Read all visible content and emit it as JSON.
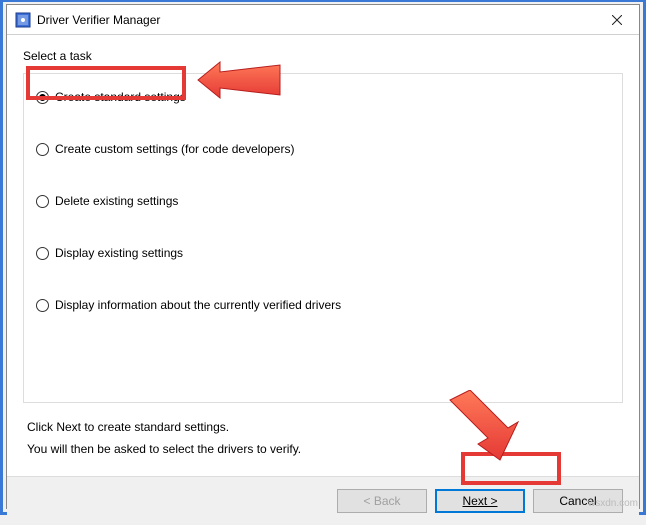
{
  "titlebar": {
    "title": "Driver Verifier Manager"
  },
  "content": {
    "select_label": "Select a task",
    "options": [
      {
        "label": "Create standard settings",
        "checked": true
      },
      {
        "label": "Create custom settings (for code developers)",
        "checked": false
      },
      {
        "label": "Delete existing settings",
        "checked": false
      },
      {
        "label": "Display existing settings",
        "checked": false
      },
      {
        "label": "Display information about the currently verified drivers",
        "checked": false
      }
    ],
    "hint1": "Click Next to create standard settings.",
    "hint2": "You will then be asked to select the drivers to verify."
  },
  "buttons": {
    "back": "< Back",
    "next": "Next >",
    "cancel": "Cancel"
  },
  "watermark": "wsxdn.com"
}
